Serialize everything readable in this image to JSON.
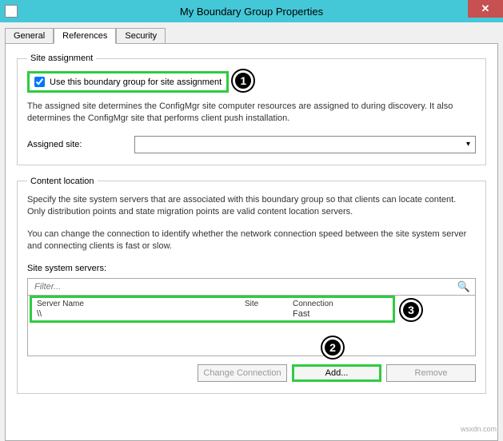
{
  "window": {
    "title": "My Boundary Group Properties"
  },
  "tabs": {
    "t0": "General",
    "t1": "References",
    "t2": "Security"
  },
  "site_assignment": {
    "legend": "Site assignment",
    "checkbox_label": "Use this boundary group for site assignment",
    "description": "The assigned site determines the ConfigMgr site computer resources are assigned to during discovery. It also determines the ConfigMgr site that performs client push installation.",
    "assigned_site_label": "Assigned site:",
    "assigned_site_value": ""
  },
  "content_location": {
    "legend": "Content location",
    "info1": "Specify the site system servers that are associated with this boundary group so that clients can locate content. Only distribution points and state migration points are valid content location servers.",
    "info2": "You can change the connection to identify whether the network connection speed between the site system server and connecting clients is fast or slow.",
    "servers_label": "Site system servers:",
    "filter_placeholder": "Filter...",
    "columns": {
      "name": "Server Name",
      "site": "Site",
      "conn": "Connection"
    },
    "rows": [
      {
        "name": "\\\\",
        "site": "",
        "conn": "Fast"
      }
    ],
    "buttons": {
      "change": "Change Connection",
      "add": "Add...",
      "remove": "Remove"
    }
  },
  "badges": {
    "b1": "1",
    "b2": "2",
    "b3": "3"
  },
  "watermark": "wsxdn.com"
}
